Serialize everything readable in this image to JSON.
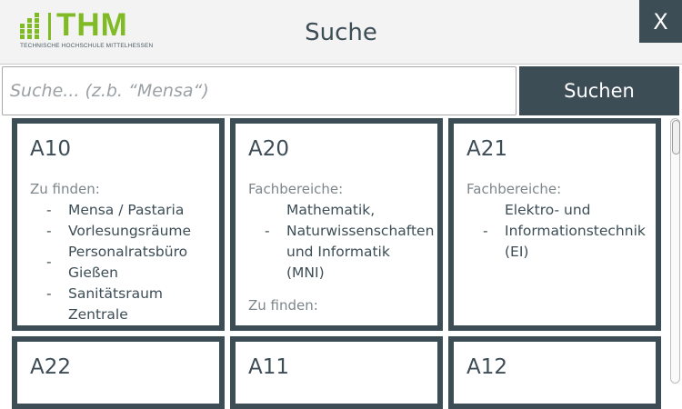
{
  "header": {
    "logo_text": "THM",
    "logo_subtitle": "TECHNISCHE HOCHSCHULE MITTELHESSEN",
    "title": "Suche",
    "close_label": "X",
    "brand_color": "#80ba24",
    "accent_color": "#3d4d56"
  },
  "search": {
    "value": "",
    "placeholder": "Suche... (z.b. “Mensa“)",
    "button_label": "Suchen"
  },
  "cards": [
    {
      "title": "A10",
      "sections": [
        {
          "label": "Zu finden:",
          "items": [
            "Mensa / Pastaria",
            "Vorlesungsräume",
            "Personalratsbüro Gießen",
            "Sanitätsraum Zentrale"
          ]
        }
      ]
    },
    {
      "title": "A20",
      "sections": [
        {
          "label": "Fachbereiche:",
          "items": [
            "Mathematik, Naturwissenschaften und Informatik (MNI)"
          ]
        },
        {
          "label": "Zu finden:",
          "items": []
        }
      ]
    },
    {
      "title": "A21",
      "sections": [
        {
          "label": "Fachbereiche:",
          "items": [
            "Elektro- und Informationstechnik (EI)"
          ]
        }
      ]
    },
    {
      "title": "A22",
      "sections": []
    },
    {
      "title": "A11",
      "sections": []
    },
    {
      "title": "A12",
      "sections": []
    }
  ]
}
